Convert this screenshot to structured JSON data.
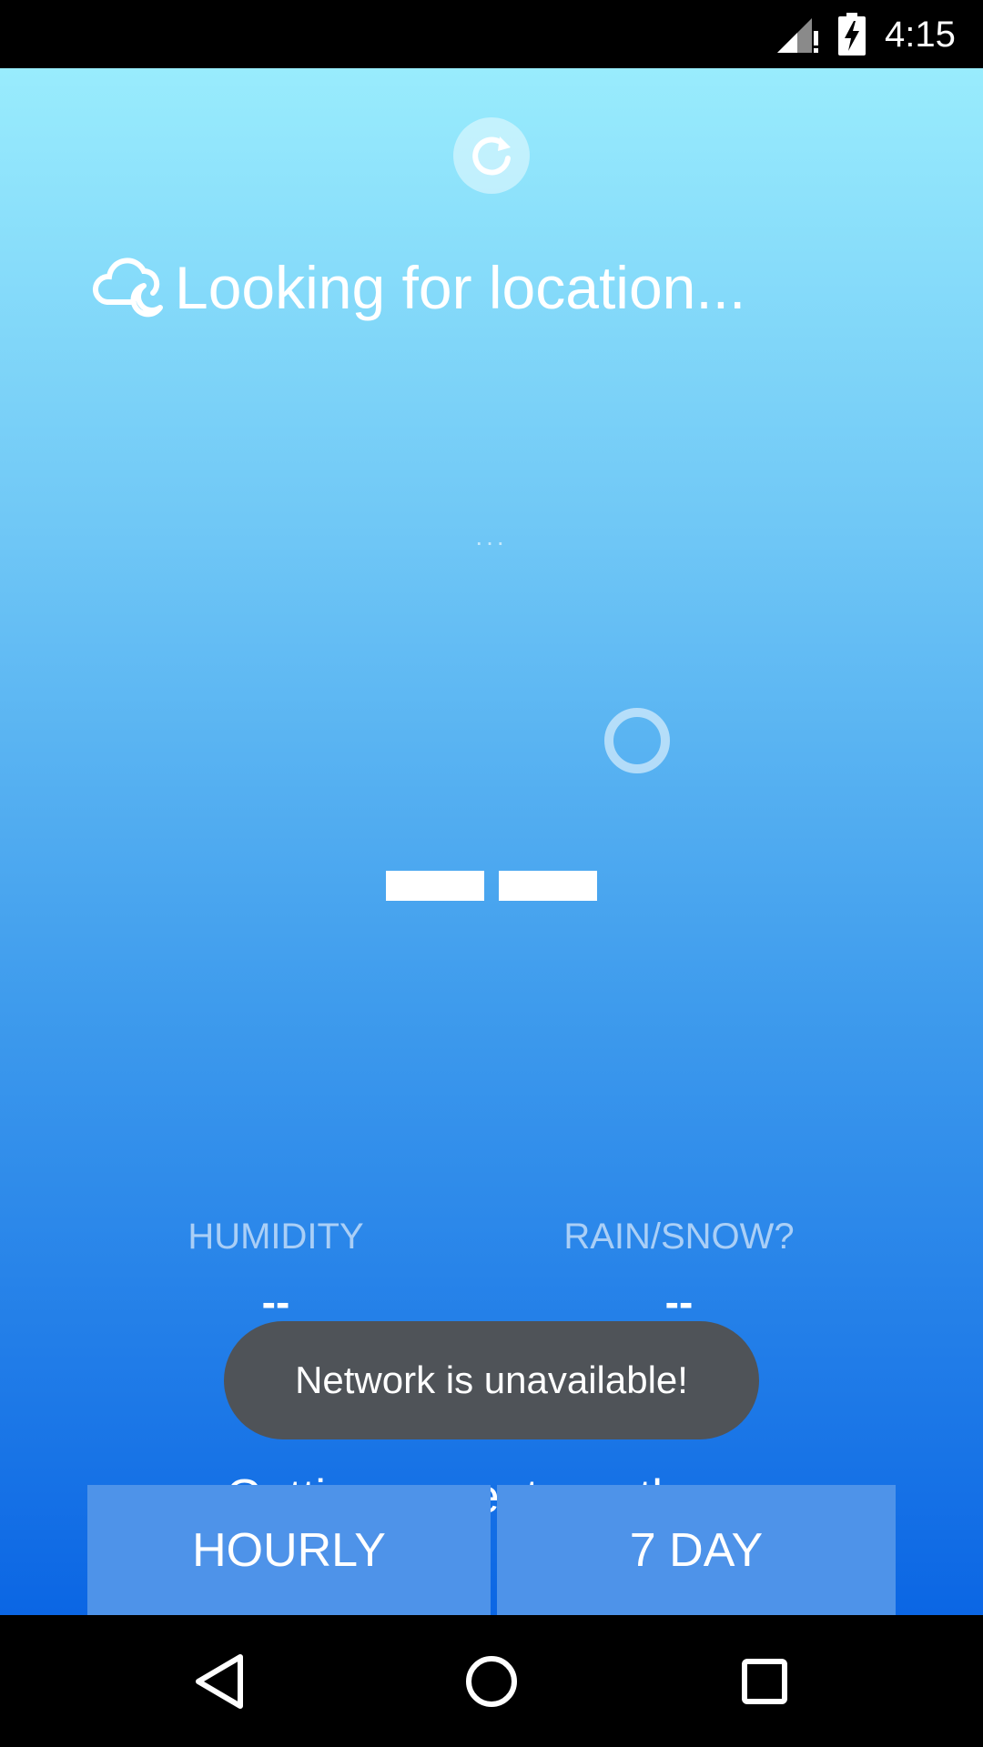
{
  "status_bar": {
    "time": "4:15",
    "icons": [
      "cell-signal-no-data-icon",
      "battery-charging-icon"
    ]
  },
  "app": {
    "refresh_icon": "refresh-icon",
    "weather_icon": "cloud-moon-icon",
    "location": "Looking for location...",
    "time_label": "...",
    "temperature": "--",
    "humidity": {
      "label": "HUMIDITY",
      "value": "--"
    },
    "precip": {
      "label": "RAIN/SNOW?",
      "value": "--"
    },
    "summary": "Getting current weather...",
    "buttons": {
      "hourly": "HOURLY",
      "daily": "7 DAY"
    },
    "toast": "Network is unavailable!",
    "colors": {
      "gradient_top": "#99ecfd",
      "gradient_bottom": "#0b66e4",
      "button": "#4e93e9",
      "toast": "#4f5358"
    }
  },
  "nav_bar": {
    "icons": [
      "back-icon",
      "home-icon",
      "recents-icon"
    ]
  }
}
